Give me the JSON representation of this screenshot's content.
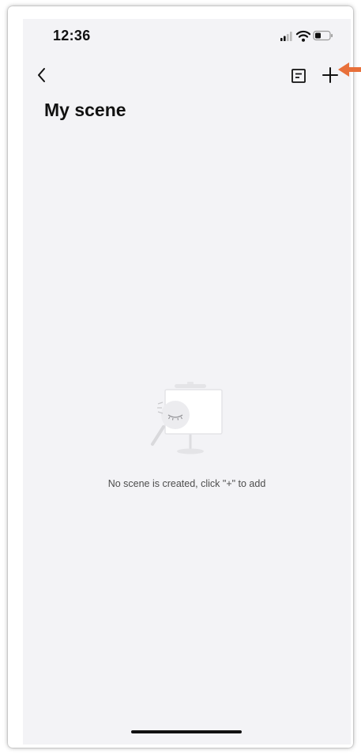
{
  "status_bar": {
    "time": "12:36"
  },
  "nav": {
    "back_icon": "chevron-left-icon",
    "list_icon": "document-list-icon",
    "add_icon": "plus-icon"
  },
  "page": {
    "title": "My scene"
  },
  "empty_state": {
    "icon": "empty-scene-illustration",
    "message": "No scene is created, click \"+\" to add"
  },
  "annotation": {
    "color": "#e8703a"
  },
  "colors": {
    "screen_background": "#f3f3f6",
    "text_primary": "#111111",
    "text_secondary": "#4d4d4d"
  }
}
